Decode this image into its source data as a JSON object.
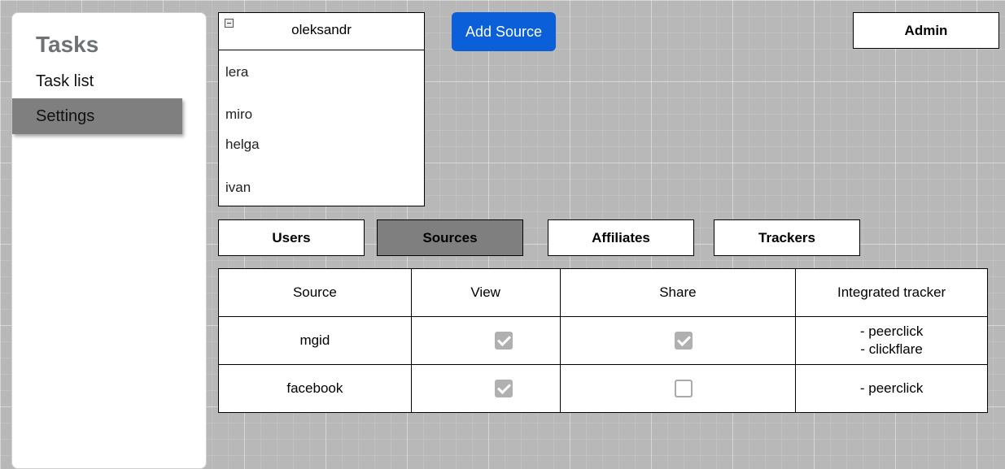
{
  "sidebar": {
    "title": "Tasks",
    "items": [
      {
        "label": "Task list",
        "active": false
      },
      {
        "label": "Settings",
        "active": true
      }
    ]
  },
  "user_panel": {
    "selected_user": "oleksandr",
    "users": [
      "lera",
      "miro",
      "helga",
      "ivan"
    ]
  },
  "actions": {
    "add_source_label": "Add Source",
    "admin_label": "Admin"
  },
  "tabs": [
    {
      "label": "Users",
      "active": false
    },
    {
      "label": "Sources",
      "active": true
    },
    {
      "label": "Affiliates",
      "active": false
    },
    {
      "label": "Trackers",
      "active": false
    }
  ],
  "table": {
    "headers": [
      "Source",
      "View",
      "Share",
      "Integrated tracker"
    ],
    "rows": [
      {
        "source": "mgid",
        "view": true,
        "share": true,
        "trackers": [
          "- peerclick",
          "- clickflare"
        ]
      },
      {
        "source": "facebook",
        "view": true,
        "share": false,
        "trackers": [
          "- peerclick"
        ]
      }
    ]
  },
  "colors": {
    "accent": "#0b5fd9",
    "active_tab": "#7f7f7f",
    "background": "#b8b8b8"
  }
}
